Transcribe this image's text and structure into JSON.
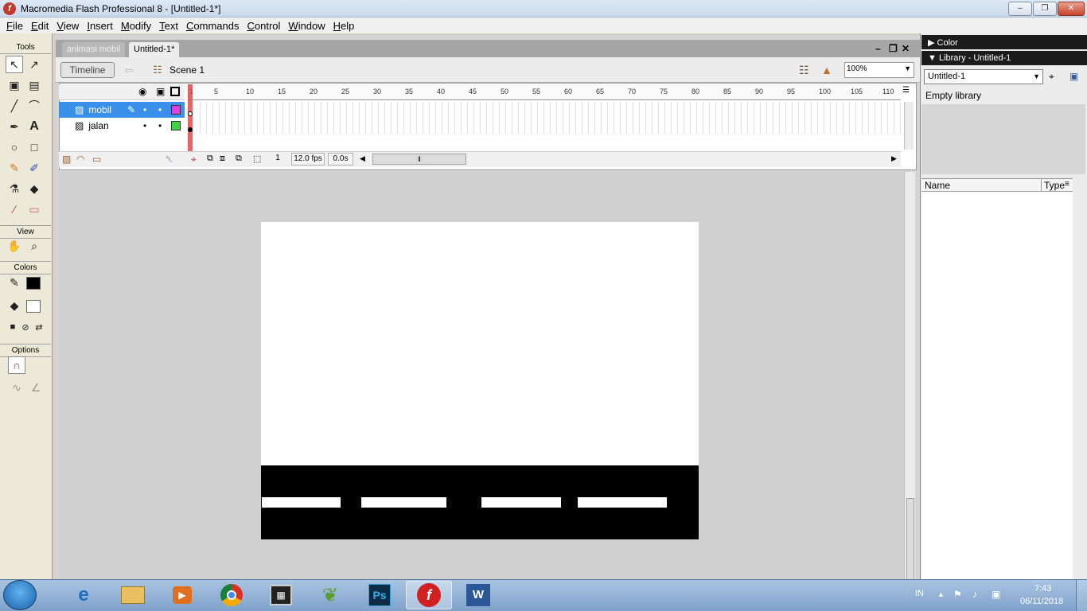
{
  "window": {
    "title": "Macromedia Flash Professional 8 - [Untitled-1*]",
    "app_icon_glyph": "f",
    "controls": [
      "–",
      "❐",
      "✕"
    ]
  },
  "menu": {
    "items": [
      "File",
      "Edit",
      "View",
      "Insert",
      "Modify",
      "Text",
      "Commands",
      "Control",
      "Window",
      "Help"
    ]
  },
  "tools": {
    "header": "Tools",
    "view_label": "View",
    "colors_label": "Colors",
    "options_label": "Options"
  },
  "documents": {
    "tabs": [
      "animasi mobil",
      "Untitled-1*"
    ],
    "active_index": 1
  },
  "edit_bar": {
    "timeline_button": "Timeline",
    "scene_label": "Scene 1",
    "zoom_value": "100%"
  },
  "timeline": {
    "layers": [
      {
        "name": "mobil",
        "color": "#e040e0",
        "selected": true
      },
      {
        "name": "jalan",
        "color": "#40d040",
        "selected": false
      }
    ],
    "ruler_ticks": [
      "1",
      "5",
      "10",
      "15",
      "20",
      "25",
      "30",
      "35",
      "40",
      "45",
      "50",
      "55",
      "60",
      "65",
      "70",
      "75",
      "80",
      "85",
      "90",
      "95",
      "100",
      "105",
      "110"
    ],
    "current_frame": "1",
    "fps": "12.0 fps",
    "elapsed": "0.0s"
  },
  "stage": {
    "background": "#ffffff",
    "road_color": "#000000",
    "lane_color": "#ffffff"
  },
  "right_panel": {
    "color_header": "Color",
    "library_header": "Library - Untitled-1",
    "library_select": "Untitled-1",
    "empty_text": "Empty library",
    "columns": [
      "Name",
      "Type"
    ]
  },
  "taskbar": {
    "apps": [
      "internet-explorer",
      "file-explorer",
      "media-player",
      "chrome",
      "movie-maker",
      "corel",
      "photoshop",
      "flash",
      "word"
    ],
    "ps_label": "Ps",
    "flash_label": "f",
    "word_label": "W",
    "lang": "IN",
    "time": "7:43",
    "date": "06/11/2018"
  }
}
